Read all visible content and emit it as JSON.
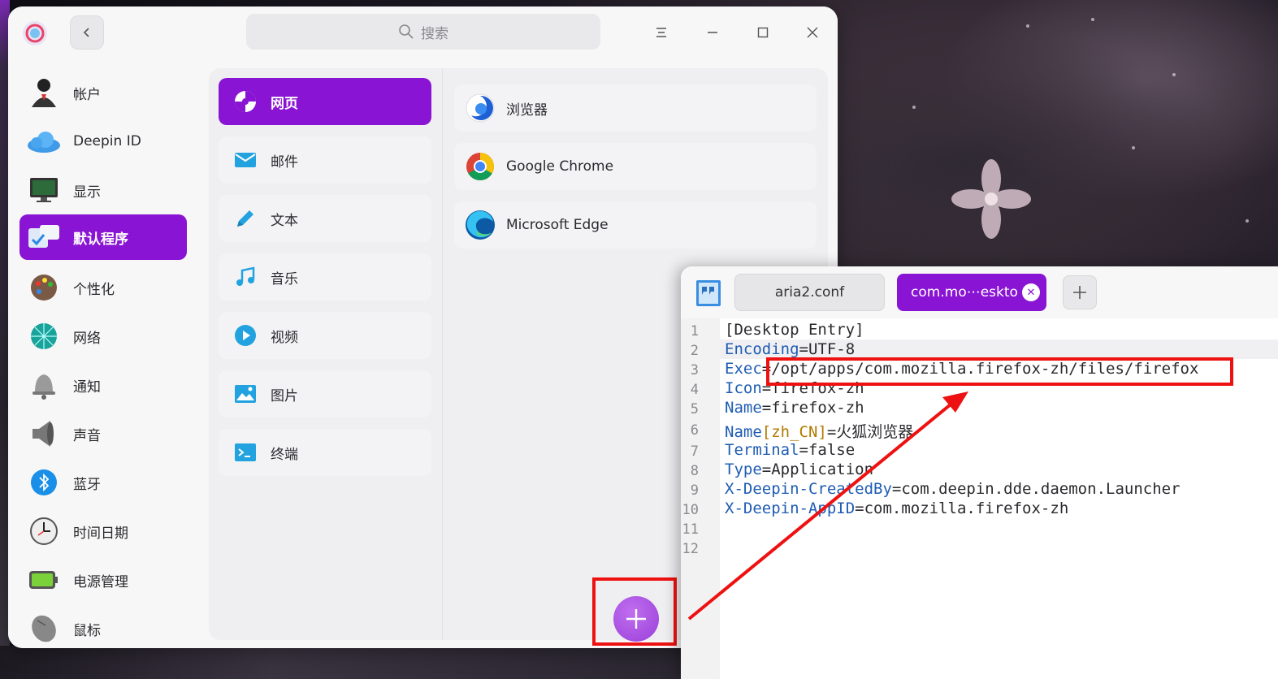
{
  "settings": {
    "search_placeholder": "搜索",
    "sidebar": [
      {
        "label": "帐户",
        "icon": "account-icon"
      },
      {
        "label": "Deepin ID",
        "icon": "cloud-icon"
      },
      {
        "label": "显示",
        "icon": "display-icon"
      },
      {
        "label": "默认程序",
        "icon": "default-apps-icon",
        "active": true
      },
      {
        "label": "个性化",
        "icon": "palette-icon"
      },
      {
        "label": "网络",
        "icon": "network-icon"
      },
      {
        "label": "通知",
        "icon": "bell-icon"
      },
      {
        "label": "声音",
        "icon": "speaker-icon"
      },
      {
        "label": "蓝牙",
        "icon": "bluetooth-icon"
      },
      {
        "label": "时间日期",
        "icon": "clock-icon"
      },
      {
        "label": "电源管理",
        "icon": "battery-icon"
      },
      {
        "label": "鼠标",
        "icon": "mouse-icon"
      }
    ],
    "categories": [
      {
        "label": "网页",
        "icon": "web-icon",
        "active": true
      },
      {
        "label": "邮件",
        "icon": "mail-icon"
      },
      {
        "label": "文本",
        "icon": "pencil-icon"
      },
      {
        "label": "音乐",
        "icon": "music-icon"
      },
      {
        "label": "视频",
        "icon": "video-icon"
      },
      {
        "label": "图片",
        "icon": "image-icon"
      },
      {
        "label": "终端",
        "icon": "terminal-icon"
      }
    ],
    "apps": [
      {
        "label": "浏览器",
        "icon": "browser-icon"
      },
      {
        "label": "Google Chrome",
        "icon": "chrome-icon"
      },
      {
        "label": "Microsoft Edge",
        "icon": "edge-icon"
      }
    ]
  },
  "editor": {
    "tabs": [
      {
        "label": "aria2.conf"
      },
      {
        "label": "com.mo⋯eskto",
        "active": true
      }
    ],
    "lines": [
      {
        "n": "1",
        "key": "[Desktop Entry]",
        "bracket": "",
        "rest": ""
      },
      {
        "n": "2",
        "key": "Encoding",
        "bracket": "",
        "rest": "=UTF-8"
      },
      {
        "n": "3",
        "key": "Exec",
        "bracket": "",
        "rest": "=/opt/apps/com.mozilla.firefox-zh/files/firefox"
      },
      {
        "n": "4",
        "key": "Icon",
        "bracket": "",
        "rest": "=firefox-zh"
      },
      {
        "n": "5",
        "key": "Name",
        "bracket": "",
        "rest": "=firefox-zh"
      },
      {
        "n": "6",
        "key": "Name",
        "bracket": "[zh_CN]",
        "rest": "=火狐浏览器"
      },
      {
        "n": "7",
        "key": "Terminal",
        "bracket": "",
        "rest": "=false"
      },
      {
        "n": "8",
        "key": "Type",
        "bracket": "",
        "rest": "=Application"
      },
      {
        "n": "9",
        "key": "X-Deepin-CreatedBy",
        "bracket": "",
        "rest": "=com.deepin.dde.daemon.Launcher"
      },
      {
        "n": "10",
        "key": "X-Deepin-AppID",
        "bracket": "",
        "rest": "=com.mozilla.firefox-zh"
      },
      {
        "n": "11",
        "key": "",
        "bracket": "",
        "rest": ""
      },
      {
        "n": "12",
        "key": "",
        "bracket": "",
        "rest": ""
      }
    ]
  },
  "colors": {
    "accent": "#8914d3",
    "annotation": "#ee1111",
    "key": "#1e5cb3",
    "bracket": "#b07a00"
  }
}
